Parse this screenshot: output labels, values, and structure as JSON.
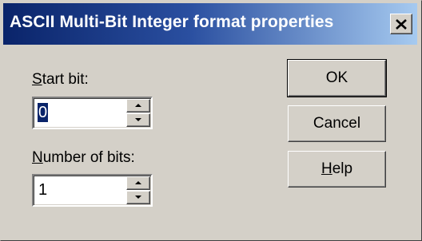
{
  "window": {
    "title": "ASCII Multi-Bit Integer format properties",
    "close_glyph": "✕"
  },
  "start_bit": {
    "label_mnemonic": "S",
    "label_rest": "tart bit:",
    "value": "0"
  },
  "number_of_bits": {
    "label_mnemonic": "N",
    "label_rest": "umber of bits:",
    "value": "1"
  },
  "buttons": {
    "ok": "OK",
    "cancel": "Cancel",
    "help_mnemonic": "H",
    "help_rest": "elp"
  },
  "colors": {
    "title_start": "#0a246a",
    "title_end": "#a6caf0",
    "face": "#d4d0c8"
  }
}
